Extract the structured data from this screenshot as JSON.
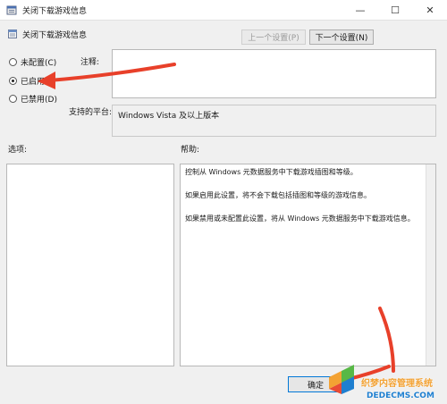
{
  "window": {
    "title": "关闭下载游戏信息",
    "controls": {
      "minimize": "—",
      "maximize": "☐",
      "close": "✕"
    }
  },
  "header": {
    "policy_title": "关闭下载游戏信息",
    "prev_button": "上一个设置(P)",
    "next_button": "下一个设置(N)"
  },
  "state": {
    "options": [
      {
        "label": "未配置(C)",
        "selected": false
      },
      {
        "label": "已启用(E)",
        "selected": true
      },
      {
        "label": "已禁用(D)",
        "selected": false
      }
    ]
  },
  "comment": {
    "label": "注释:",
    "value": ""
  },
  "platform": {
    "label": "支持的平台:",
    "value": "Windows Vista 及以上版本"
  },
  "options_section": {
    "label": "选项:"
  },
  "help_section": {
    "label": "帮助:",
    "paragraphs": [
      "控制从 Windows 元数据服务中下载游戏插图和等级。",
      "如果启用此设置，将不会下载包括插图和等级的游戏信息。",
      "如果禁用或未配置此设置，将从 Windows 元数据服务中下载游戏信息。"
    ]
  },
  "footer": {
    "ok_button": "确定"
  },
  "annotation_colors": {
    "arrow": "#e8402a"
  },
  "watermark": {
    "line1": "织梦内容管理系统",
    "line2": "DEDECMS.COM"
  }
}
